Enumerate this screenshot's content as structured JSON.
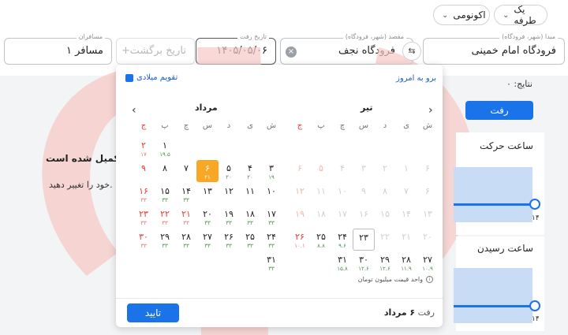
{
  "top": {
    "trip_type": "یک طرفه",
    "cabin_class": "اکونومی"
  },
  "search": {
    "origin_label": "مبدا (شهر، فرودگاه)",
    "origin_value": "فرودگاه امام خمینی",
    "destination_label": "مقصد (شهر، فرودگاه)",
    "destination_value": "فرودگاه نجف",
    "departure_label": "تاریخ رفت",
    "departure_value": "۱۴۰۵/۰۵/۰۶",
    "return_placeholder": "تاریخ برگشت",
    "return_plus": "+",
    "passengers_label": "مسافران",
    "passengers_value": "۱ مسافر"
  },
  "background": {
    "results_count": "نتایج: ۰",
    "outbound_tab": "رفت",
    "departure_time": "ساعت حرکت",
    "arrival_time": "ساعت رسیدن",
    "slider_max": "۱۴",
    "message_title": "تکمیل شده است.",
    "message_body": "خود را تغییر دهید."
  },
  "calendar": {
    "goto_today": "برو به امروز",
    "gregorian_toggle": "تقویم میلادی",
    "weekdays": [
      "ش",
      "ی",
      "د",
      "س",
      "چ",
      "پ",
      "ج"
    ],
    "months": [
      {
        "title": "تیر",
        "cells": [
          {
            "n": "",
            "p": ""
          },
          {
            "n": "",
            "p": ""
          },
          {
            "n": "",
            "p": ""
          },
          {
            "n": "",
            "p": ""
          },
          {
            "n": "",
            "p": ""
          },
          {
            "n": "",
            "p": ""
          },
          {
            "n": "",
            "p": ""
          },
          {
            "n": "۶",
            "p": "",
            "s": "disabled"
          },
          {
            "n": "۱",
            "p": "",
            "s": "disabled"
          },
          {
            "n": "۲",
            "p": "",
            "s": "disabled"
          },
          {
            "n": "۳",
            "p": "",
            "s": "disabled"
          },
          {
            "n": "۴",
            "p": "",
            "s": "disabled"
          },
          {
            "n": "۵",
            "p": "",
            "s": "disabled holiday"
          },
          {
            "n": "۶",
            "p": "",
            "s": "disabled holiday"
          },
          {
            "n": "۶",
            "p": "",
            "s": "disabled"
          },
          {
            "n": "۷",
            "p": "",
            "s": "disabled"
          },
          {
            "n": "۸",
            "p": "",
            "s": "disabled"
          },
          {
            "n": "۹",
            "p": "",
            "s": "disabled"
          },
          {
            "n": "۱۰",
            "p": "",
            "s": "disabled"
          },
          {
            "n": "۱۱",
            "p": "",
            "s": "disabled"
          },
          {
            "n": "۱۲",
            "p": "",
            "s": "disabled holiday"
          },
          {
            "n": "۱۳",
            "p": "",
            "s": "disabled"
          },
          {
            "n": "۱۴",
            "p": "",
            "s": "disabled"
          },
          {
            "n": "۱۵",
            "p": "",
            "s": "disabled"
          },
          {
            "n": "۱۶",
            "p": "",
            "s": "disabled"
          },
          {
            "n": "۱۷",
            "p": "",
            "s": "disabled"
          },
          {
            "n": "۱۸",
            "p": "",
            "s": "disabled"
          },
          {
            "n": "۱۹",
            "p": "",
            "s": "disabled holiday"
          },
          {
            "n": "۲۰",
            "p": "",
            "s": "disabled"
          },
          {
            "n": "۲۱",
            "p": "",
            "s": "disabled"
          },
          {
            "n": "۲۲",
            "p": "",
            "s": "disabled"
          },
          {
            "n": "۲۳",
            "p": "",
            "s": "today"
          },
          {
            "n": "۲۴",
            "p": "۹.۶"
          },
          {
            "n": "۲۵",
            "p": "۸.۸"
          },
          {
            "n": "۲۶",
            "p": "۱۰.۱",
            "s": "holiday"
          },
          {
            "n": "۲۷",
            "p": "۱۰.۹"
          },
          {
            "n": "۲۸",
            "p": "۱۱.۹"
          },
          {
            "n": "۲۹",
            "p": "۱۲.۶"
          },
          {
            "n": "۳۰",
            "p": "۱۲.۶"
          },
          {
            "n": "۳۱",
            "p": "۱۵.۸"
          },
          {
            "n": "",
            "p": ""
          },
          {
            "n": "",
            "p": ""
          }
        ]
      },
      {
        "title": "مرداد",
        "cells": [
          {
            "n": "",
            "p": ""
          },
          {
            "n": "",
            "p": ""
          },
          {
            "n": "",
            "p": ""
          },
          {
            "n": "",
            "p": ""
          },
          {
            "n": "",
            "p": ""
          },
          {
            "n": "۱",
            "p": "۱۹.۵"
          },
          {
            "n": "۲",
            "p": "۱۷",
            "s": "holiday"
          },
          {
            "n": "۳",
            "p": "۱۹"
          },
          {
            "n": "۴",
            "p": "۲۰"
          },
          {
            "n": "۵",
            "p": "۲۰"
          },
          {
            "n": "۶",
            "p": "۲۱",
            "s": "selected"
          },
          {
            "n": "۷",
            "p": ""
          },
          {
            "n": "۸",
            "p": ""
          },
          {
            "n": "۹",
            "p": "",
            "s": "holiday"
          },
          {
            "n": "۱۰",
            "p": ""
          },
          {
            "n": "۱۱",
            "p": ""
          },
          {
            "n": "۱۲",
            "p": ""
          },
          {
            "n": "۱۳",
            "p": ""
          },
          {
            "n": "۱۴",
            "p": "۳۳"
          },
          {
            "n": "۱۵",
            "p": "۳۳"
          },
          {
            "n": "۱۶",
            "p": "۳۳",
            "s": "holiday"
          },
          {
            "n": "۱۷",
            "p": "۳۳"
          },
          {
            "n": "۱۸",
            "p": "۳۳"
          },
          {
            "n": "۱۹",
            "p": "۳۳"
          },
          {
            "n": "۲۰",
            "p": "۳۳"
          },
          {
            "n": "۲۱",
            "p": "۳۳",
            "s": "holiday"
          },
          {
            "n": "۲۲",
            "p": "۳۳",
            "s": "holiday"
          },
          {
            "n": "۲۳",
            "p": "۳۳",
            "s": "holiday"
          },
          {
            "n": "۲۴",
            "p": "۳۳"
          },
          {
            "n": "۲۵",
            "p": "۳۳"
          },
          {
            "n": "۲۶",
            "p": "۳۳"
          },
          {
            "n": "۲۷",
            "p": "۳۳"
          },
          {
            "n": "۲۸",
            "p": "۳۳"
          },
          {
            "n": "۲۹",
            "p": "۳۳"
          },
          {
            "n": "۳۰",
            "p": "۳۳",
            "s": "holiday"
          },
          {
            "n": "۳۱",
            "p": "۳۳"
          },
          {
            "n": "",
            "p": ""
          },
          {
            "n": "",
            "p": ""
          },
          {
            "n": "",
            "p": ""
          },
          {
            "n": "",
            "p": ""
          },
          {
            "n": "",
            "p": ""
          },
          {
            "n": "",
            "p": ""
          }
        ]
      }
    ],
    "price_unit_note": "واحد قیمت میلیون تومان",
    "summary_prefix": "رفت",
    "summary_date": "۶ مرداد",
    "confirm": "تایید",
    "nav_prev": "‹",
    "nav_next": "›"
  }
}
